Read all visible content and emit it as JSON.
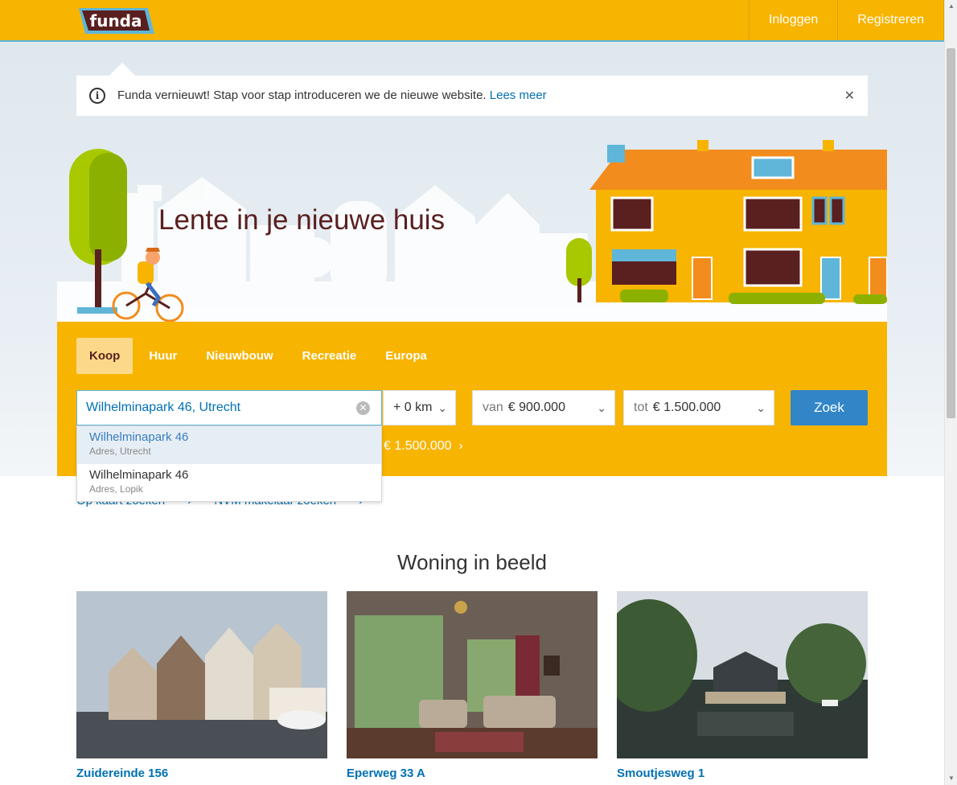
{
  "brand": {
    "logo_text": "funda"
  },
  "header": {
    "nav": [
      {
        "label": "Inloggen"
      },
      {
        "label": "Registreren"
      }
    ]
  },
  "notice": {
    "text": "Funda vernieuwt! Stap voor stap introduceren we de nieuwe website.",
    "link": "Lees meer",
    "info_icon": "info-icon",
    "close_icon": "close-icon"
  },
  "hero": {
    "title": "Lente in je nieuwe huis"
  },
  "search": {
    "tabs": [
      {
        "label": "Koop",
        "active": true
      },
      {
        "label": "Huur"
      },
      {
        "label": "Nieuwbouw"
      },
      {
        "label": "Recreatie"
      },
      {
        "label": "Europa"
      }
    ],
    "address_value": "Wilhelminapark 46, Utrecht",
    "radius": "+ 0 km",
    "price_from_prefix": "van",
    "price_from": "€ 900.000",
    "price_to_prefix": "tot",
    "price_to": "€ 1.500.000",
    "submit_label": "Zoek",
    "recent_search": "€ 1.500.000",
    "suggestions": [
      {
        "title": "Wilhelminapark 46",
        "subtitle": "Adres, Utrecht",
        "highlighted": true
      },
      {
        "title": "Wilhelminapark 46",
        "subtitle": "Adres, Lopik"
      }
    ]
  },
  "links": [
    {
      "label": "Op kaart zoeken"
    },
    {
      "label": "NVM makelaar zoeken"
    }
  ],
  "featured": {
    "title": "Woning in beeld",
    "items": [
      {
        "address": "Zuidereinde 156"
      },
      {
        "address": "Eperweg 33 A"
      },
      {
        "address": "Smoutjesweg 1"
      }
    ]
  },
  "colors": {
    "brand": "#f7b400",
    "link": "#0071b3",
    "button": "#3286c8",
    "title": "#5a1f1f"
  }
}
